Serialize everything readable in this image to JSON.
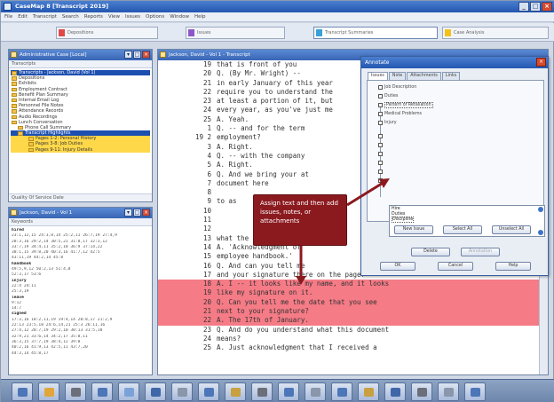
{
  "window": {
    "title": "CaseMap 8 [Transcript 2019]",
    "controls": [
      "_",
      "□",
      "×"
    ]
  },
  "menu": [
    "File",
    "Edit",
    "Transcript",
    "Search",
    "Reports",
    "View",
    "Issues",
    "Options",
    "Window",
    "Help"
  ],
  "tabs": [
    {
      "label": "Depositions",
      "icon_color": "#e04848"
    },
    {
      "label": "Issues",
      "icon_color": "#8e55c8"
    },
    {
      "label": "Transcript Summaries",
      "icon_color": "#3aa0d8"
    },
    {
      "label": "Case Analysis",
      "icon_color": "#f2c21a"
    }
  ],
  "left_top_panel": {
    "title": "Administrative Case [Local]",
    "subbar": "Transcripts",
    "filter_label": "Quality Of Service Date",
    "tree": [
      {
        "label": "Transcripts - Jackson, David (Vol 1)",
        "state": "sel"
      },
      {
        "label": "Depositions",
        "state": ""
      },
      {
        "label": "Exhibits",
        "state": ""
      },
      {
        "label": "Employment Contract",
        "state": ""
      },
      {
        "label": "Benefit Plan Summary",
        "state": ""
      },
      {
        "label": "Internal Email Log",
        "state": ""
      },
      {
        "label": "Personnel File Notes",
        "state": ""
      },
      {
        "label": "Attendance Records",
        "state": ""
      },
      {
        "label": "Audio Recordings",
        "state": ""
      },
      {
        "label": "Lunch Conversation",
        "state": ""
      },
      {
        "label": "Phone Call Summary",
        "state": ""
      },
      {
        "label": "Transcript Highlights",
        "state": "sel"
      },
      {
        "label": "Pages 1-2: Personal History",
        "state": "hl"
      },
      {
        "label": "Pages 3-8: Job Duties",
        "state": "hl"
      },
      {
        "label": "Pages 9-11: Injury Details",
        "state": "hl"
      }
    ]
  },
  "left_bottom_panel": {
    "title": "Jackson, David - Vol 1",
    "subbar": "Keywords",
    "rows": [
      {
        "text": "hired",
        "hdr": true
      },
      {
        "text": "23:1,12,15 24:3,8,14 25:2,11 26:7,19 27:4,9",
        "hdr": false
      },
      {
        "text": "28:3,16 29:2,14 30:5,21 31:8,17 32:3,12",
        "hdr": false
      },
      {
        "text": "33:7,19 34:4,11 35:2,18 36:9 37:14,22",
        "hdr": false
      },
      {
        "text": "38:1,15 39:8,20 40:3,16 41:7,12 42:5",
        "hdr": false
      },
      {
        "text": "43:11,19 44:2,14 45:8",
        "hdr": false
      },
      {
        "text": "handbook",
        "hdr": true
      },
      {
        "text": "49:5,9,12 50:2,13 51:4,8",
        "hdr": false
      },
      {
        "text": "52:3,17 53:6",
        "hdr": false
      },
      {
        "text": "injury",
        "hdr": true
      },
      {
        "text": "22:4 24:11",
        "hdr": false
      },
      {
        "text": "25:3,19",
        "hdr": false
      },
      {
        "text": "leave",
        "hdr": true
      },
      {
        "text": "9:12",
        "hdr": false
      },
      {
        "text": "14:7",
        "hdr": false
      },
      {
        "text": "signed",
        "hdr": true
      },
      {
        "text": "17:3,16 18:2,11,19 19:4,14 20:8,17 21:2,9",
        "hdr": false
      },
      {
        "text": "22:13 23:5,18 24:6,14,21 25:3 26:11,16",
        "hdr": false
      },
      {
        "text": "27:4,12 28:7,19 29:2,10 30:13 31:5,18",
        "hdr": false
      },
      {
        "text": "32:9,21 33:6,14 34:2,17 35:8,11",
        "hdr": false
      },
      {
        "text": "36:3,15 37:7,19 38:4,12 39:8",
        "hdr": false
      },
      {
        "text": "40:2,16 41:9,13 42:5,11 43:7,20",
        "hdr": false
      },
      {
        "text": "44:3,14 45:8,17",
        "hdr": false
      }
    ]
  },
  "transcript_panel": {
    "title": "Jackson, David - Vol 1 - Transcript",
    "lines": [
      {
        "num": "19",
        "text": "that is front of you",
        "pink": false
      },
      {
        "num": "20",
        "text": "    Q.   (By Mr. Wright)  --",
        "pink": false
      },
      {
        "num": "21",
        "text": "in early January of this year",
        "pink": false
      },
      {
        "num": "22",
        "text": "require you to understand the",
        "pink": false
      },
      {
        "num": "23",
        "text": "at least a portion of it, but",
        "pink": false
      },
      {
        "num": "24",
        "text": "every year, as you've just me",
        "pink": false
      },
      {
        "num": "25",
        "text": "    A.   Yeah.",
        "pink": false
      },
      {
        "num": "1",
        "text": "    Q.   -- and for the term",
        "pink": false
      },
      {
        "num": "19 2",
        "text": "employment?",
        "pink": false
      },
      {
        "num": "3",
        "text": "    A.   Right.",
        "pink": false
      },
      {
        "num": "4",
        "text": "    Q.   -- with the company",
        "pink": false
      },
      {
        "num": "5",
        "text": "    A.   Right.",
        "pink": false
      },
      {
        "num": "6",
        "text": "    Q.   And we bring your at",
        "pink": false
      },
      {
        "num": "7",
        "text": "document here",
        "pink": false
      },
      {
        "num": "8",
        "text": "",
        "pink": false
      },
      {
        "num": "9",
        "text": "    to as",
        "pink": false
      },
      {
        "num": "10",
        "text": "",
        "pink": false
      },
      {
        "num": "11",
        "text": "",
        "pink": false
      },
      {
        "num": "12",
        "text": "",
        "pink": false
      },
      {
        "num": "13",
        "text": "what the",
        "pink": false
      },
      {
        "num": "14",
        "text": "    A.   'Acknowledgment of",
        "pink": false
      },
      {
        "num": "15",
        "text": "employee handbook.'",
        "pink": false
      },
      {
        "num": "16",
        "text": "    Q.   And can you tell me",
        "pink": false
      },
      {
        "num": "17",
        "text": "and your signature there on the page?",
        "pink": false
      },
      {
        "num": "18",
        "text": "    A.   I -- it looks like my name, and it looks",
        "pink": true
      },
      {
        "num": "19",
        "text": "like my signature on it.",
        "pink": true
      },
      {
        "num": "20",
        "text": "    Q.   Can you tell me the date that you see",
        "pink": true
      },
      {
        "num": "21",
        "text": "next to your signature?",
        "pink": true
      },
      {
        "num": "22",
        "text": "    A.   The 17th of January.",
        "pink": true
      },
      {
        "num": "23",
        "text": "    Q.   And do you understand what this document",
        "pink": false
      },
      {
        "num": "24",
        "text": "means?",
        "pink": false
      },
      {
        "num": "25",
        "text": "    A.   Just acknowledgment that I received a",
        "pink": false
      }
    ]
  },
  "dialog": {
    "title": "Annotate",
    "tabs": [
      "Issues",
      "Note",
      "Attachments",
      "Links"
    ],
    "checkboxes": [
      {
        "label": "Job Description",
        "boxed": false
      },
      {
        "label": "Duties",
        "boxed": false
      },
      {
        "label": "Pattern of Retaliation",
        "boxed": true
      },
      {
        "label": "Medical Problems",
        "boxed": false
      },
      {
        "label": "Injury",
        "boxed": false
      }
    ],
    "list_items": [
      {
        "label": "Hire",
        "boxed": false
      },
      {
        "label": "Duties",
        "boxed": false
      },
      {
        "label": "Discipline",
        "boxed": true
      }
    ],
    "mid_buttons": [
      "New Issue",
      "Select All",
      "Unselect All"
    ],
    "row_buttons": [
      {
        "label": "Delete",
        "disabled": false
      },
      {
        "label": "Annotation",
        "disabled": true
      }
    ],
    "bottom_buttons": [
      "OK",
      "Cancel",
      "Help"
    ]
  },
  "callout": {
    "text": "Assign text and then add issues, notes, or attachments"
  },
  "taskbar": {
    "icon_colors": [
      "#4d76b8",
      "#e0a63a",
      "#6b6f7a",
      "#4d76b8",
      "#7aa2d8",
      "#3f66a8",
      "#8a96aa",
      "#4d76b8",
      "#c8a040",
      "#6b6f7a",
      "#4d76b8",
      "#8a96aa",
      "#4d76b8",
      "#c8a040",
      "#3f66a8",
      "#6b6f7a",
      "#8a96aa",
      "#4d76b8"
    ]
  }
}
